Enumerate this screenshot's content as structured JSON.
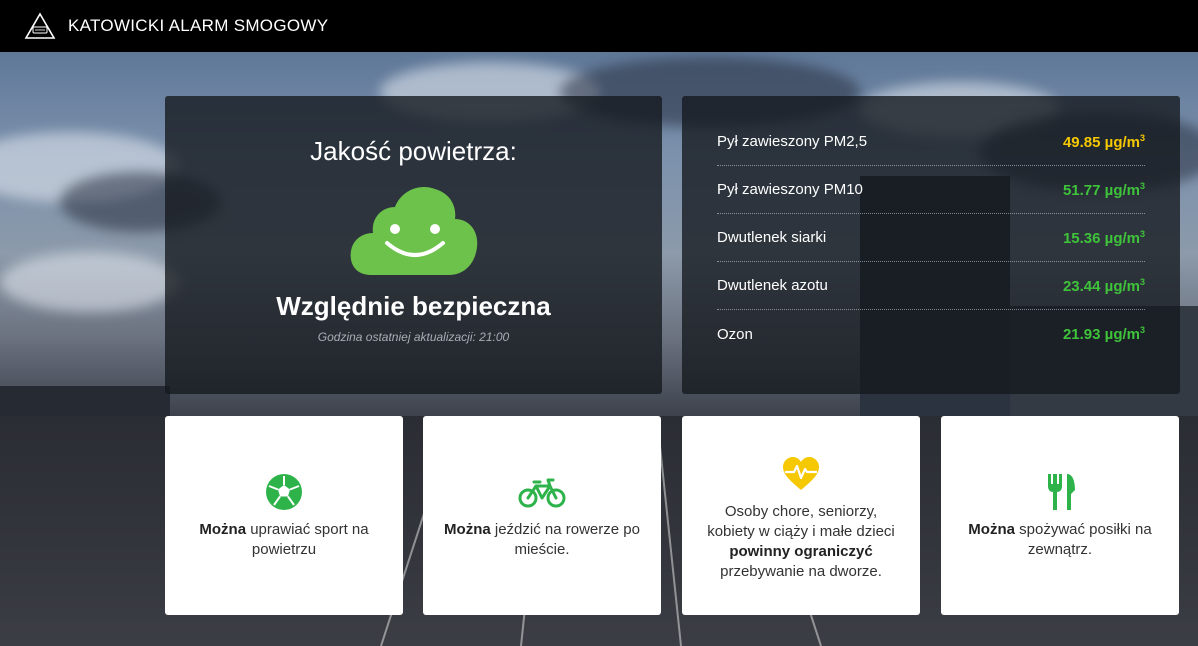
{
  "header": {
    "title": "KATOWICKI ALARM SMOGOWY",
    "logo_icon": "smog-alert-triangle-icon"
  },
  "quality": {
    "title": "Jakość powietrza:",
    "status": "Względnie bezpieczna",
    "last_update": "Godzina ostatniej aktualizacji: 21:00",
    "icon": "happy-cloud-icon",
    "icon_color": "#6cc24a"
  },
  "pollutants": [
    {
      "name": "Pył zawieszony PM2,5",
      "value": "49.85",
      "unit": "µg/m",
      "unit_sup": "3",
      "color": "#f5c800"
    },
    {
      "name": "Pył zawieszony PM10",
      "value": "51.77",
      "unit": "µg/m",
      "unit_sup": "3",
      "color": "#3ec33a"
    },
    {
      "name": "Dwutlenek siarki",
      "value": "15.36",
      "unit": "µg/m",
      "unit_sup": "3",
      "color": "#3ec33a"
    },
    {
      "name": "Dwutlenek azotu",
      "value": "23.44",
      "unit": "µg/m",
      "unit_sup": "3",
      "color": "#3ec33a"
    },
    {
      "name": "Ozon",
      "value": "21.93",
      "unit": "µg/m",
      "unit_sup": "3",
      "color": "#3ec33a"
    }
  ],
  "advice": [
    {
      "icon": "soccer-ball-icon",
      "color": "#2db34a",
      "bold": "Można",
      "text": " uprawiać sport na powietrzu"
    },
    {
      "icon": "bicycle-icon",
      "color": "#2db34a",
      "bold": "Można",
      "text": " jeździć na rowerze po mieście."
    },
    {
      "icon": "heartbeat-icon",
      "color": "#f5c800",
      "pre": "Osoby chore, seniorzy, kobiety w ciąży i małe dzieci ",
      "bold": "powinny ograniczyć",
      "text": " przebywanie na dworze."
    },
    {
      "icon": "fork-knife-icon",
      "color": "#2db34a",
      "bold": "Można",
      "text": " spożywać posiłki na zewnątrz."
    }
  ]
}
